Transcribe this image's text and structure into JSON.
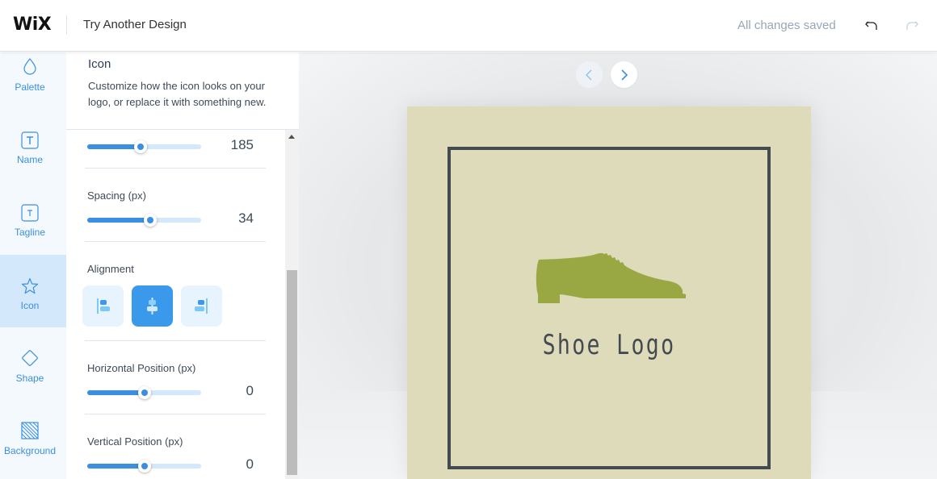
{
  "header": {
    "brand": "WiX",
    "title": "Try Another Design",
    "status": "All changes saved",
    "undo_icon": "undo-icon",
    "redo_icon": "redo-icon"
  },
  "rail": {
    "items": [
      {
        "label": "Palette",
        "icon": "droplet-icon",
        "active": false
      },
      {
        "label": "Name",
        "icon": "text-t-icon",
        "active": false
      },
      {
        "label": "Tagline",
        "icon": "text-t-small-icon",
        "active": false
      },
      {
        "label": "Icon",
        "icon": "star-icon",
        "active": true
      },
      {
        "label": "Shape",
        "icon": "diamond-icon",
        "active": false
      },
      {
        "label": "Background",
        "icon": "hatched-square-icon",
        "active": false
      }
    ]
  },
  "panel": {
    "title": "Icon",
    "description": "Customize how the icon looks on your logo, or replace it with something new.",
    "size_slider": {
      "value": "185",
      "fraction": 0.47
    },
    "spacing": {
      "label": "Spacing (px)",
      "value": "34",
      "fraction": 0.55
    },
    "alignment": {
      "label": "Alignment",
      "options": [
        {
          "name": "align-left",
          "active": false
        },
        {
          "name": "align-center",
          "active": true
        },
        {
          "name": "align-right",
          "active": false
        }
      ]
    },
    "horizontal_position": {
      "label": "Horizontal Position (px)",
      "value": "0",
      "fraction": 0.5
    },
    "vertical_position": {
      "label": "Vertical Position (px)",
      "value": "0",
      "fraction": 0.5
    }
  },
  "canvas": {
    "prev_icon": "chevron-left-icon",
    "next_icon": "chevron-right-icon",
    "logo_text": "Shoe Logo",
    "colors": {
      "background": "#dedbbb",
      "frame": "#434a50",
      "icon": "#99a843",
      "text": "#434a50"
    }
  },
  "colors": {
    "accent": "#3b8fe0",
    "accent_light": "#d3e8fa"
  }
}
